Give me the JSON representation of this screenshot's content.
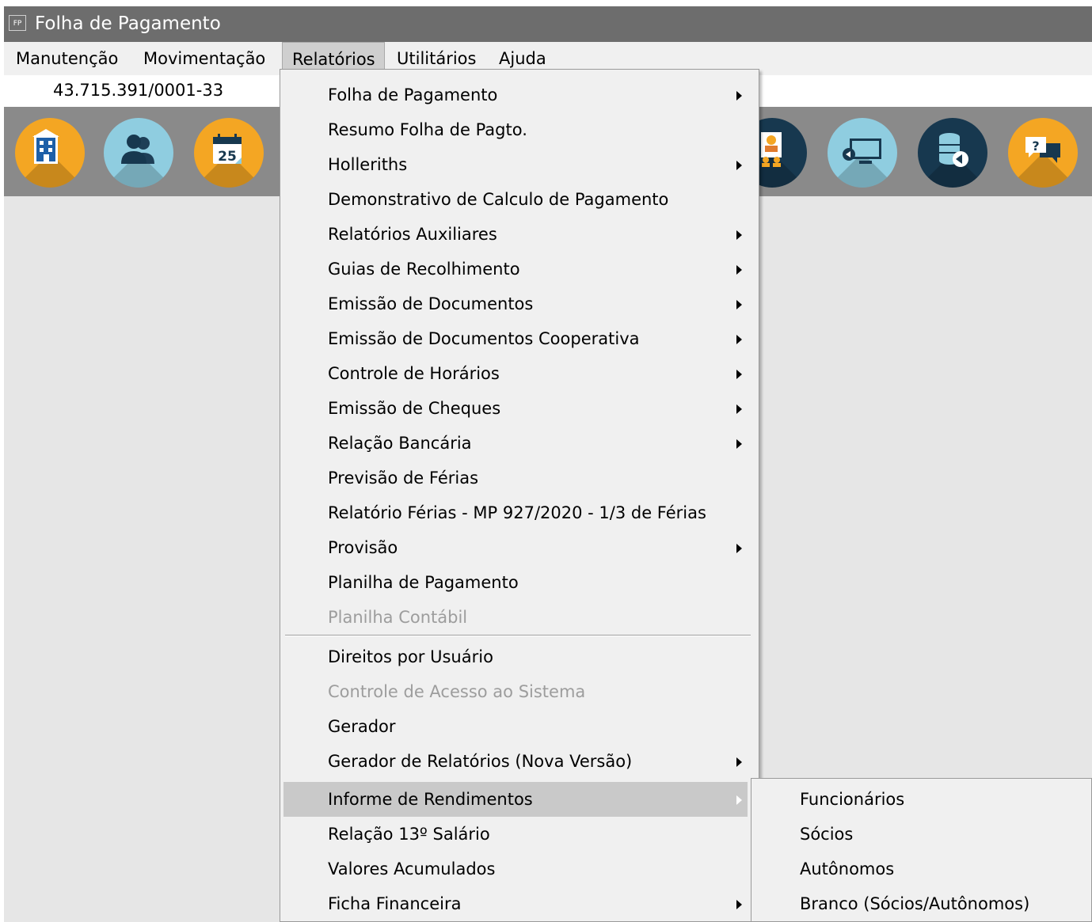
{
  "window": {
    "app_icon_text": "FP",
    "title": "Folha de Pagamento"
  },
  "menubar": {
    "items": [
      "Manutenção",
      "Movimentação",
      "Relatórios",
      "Utilitários",
      "Ajuda"
    ],
    "active": "Relatórios"
  },
  "company": {
    "cnpj": "43.715.391/0001-33"
  },
  "toolbar": {
    "buttons": [
      {
        "icon": "building-icon",
        "color": "#f4a623"
      },
      {
        "icon": "users-icon",
        "color": "#8fcde0"
      },
      {
        "icon": "calendar-icon",
        "color": "#f4a623",
        "text": "25"
      },
      {
        "icon": "people-board-icon",
        "color": "#17384f"
      },
      {
        "icon": "monitor-arrow-icon",
        "color": "#8fcde0"
      },
      {
        "icon": "database-restore-icon",
        "color": "#17384f"
      },
      {
        "icon": "help-chat-icon",
        "color": "#f4a623",
        "text": "?"
      }
    ]
  },
  "relatorios_menu": {
    "items": [
      {
        "label": "Folha de Pagamento",
        "submenu": true,
        "enabled": true
      },
      {
        "label": "Resumo Folha de Pagto.",
        "submenu": false,
        "enabled": true
      },
      {
        "label": "Holleriths",
        "submenu": true,
        "enabled": true
      },
      {
        "label": "Demonstrativo de Calculo de Pagamento",
        "submenu": false,
        "enabled": true
      },
      {
        "label": "Relatórios Auxiliares",
        "submenu": true,
        "enabled": true
      },
      {
        "label": "Guias de Recolhimento",
        "submenu": true,
        "enabled": true
      },
      {
        "label": "Emissão de Documentos",
        "submenu": true,
        "enabled": true
      },
      {
        "label": "Emissão de Documentos Cooperativa",
        "submenu": true,
        "enabled": true
      },
      {
        "label": "Controle de Horários",
        "submenu": true,
        "enabled": true
      },
      {
        "label": "Emissão de Cheques",
        "submenu": true,
        "enabled": true
      },
      {
        "label": "Relação Bancária",
        "submenu": true,
        "enabled": true
      },
      {
        "label": "Previsão de Férias",
        "submenu": false,
        "enabled": true
      },
      {
        "label": "Relatório Férias - MP 927/2020 - 1/3 de Férias",
        "submenu": false,
        "enabled": true
      },
      {
        "label": "Provisão",
        "submenu": true,
        "enabled": true
      },
      {
        "label": "Planilha de Pagamento",
        "submenu": false,
        "enabled": true
      },
      {
        "label": "Planilha Contábil",
        "submenu": false,
        "enabled": false
      },
      {
        "label": "Direitos por Usuário",
        "submenu": false,
        "enabled": true
      },
      {
        "label": "Controle de Acesso ao Sistema",
        "submenu": false,
        "enabled": false
      },
      {
        "label": "Gerador",
        "submenu": false,
        "enabled": true
      },
      {
        "label": "Gerador de Relatórios (Nova Versão)",
        "submenu": true,
        "enabled": true
      },
      {
        "label": "Informe de Rendimentos",
        "submenu": true,
        "enabled": true,
        "highlighted": true
      },
      {
        "label": "Relação 13º Salário",
        "submenu": false,
        "enabled": true
      },
      {
        "label": "Valores Acumulados",
        "submenu": false,
        "enabled": true
      },
      {
        "label": "Ficha Financeira",
        "submenu": true,
        "enabled": true
      }
    ]
  },
  "informe_submenu": {
    "items": [
      "Funcionários",
      "Sócios",
      "Autônomos",
      "Branco (Sócios/Autônomos)"
    ]
  }
}
